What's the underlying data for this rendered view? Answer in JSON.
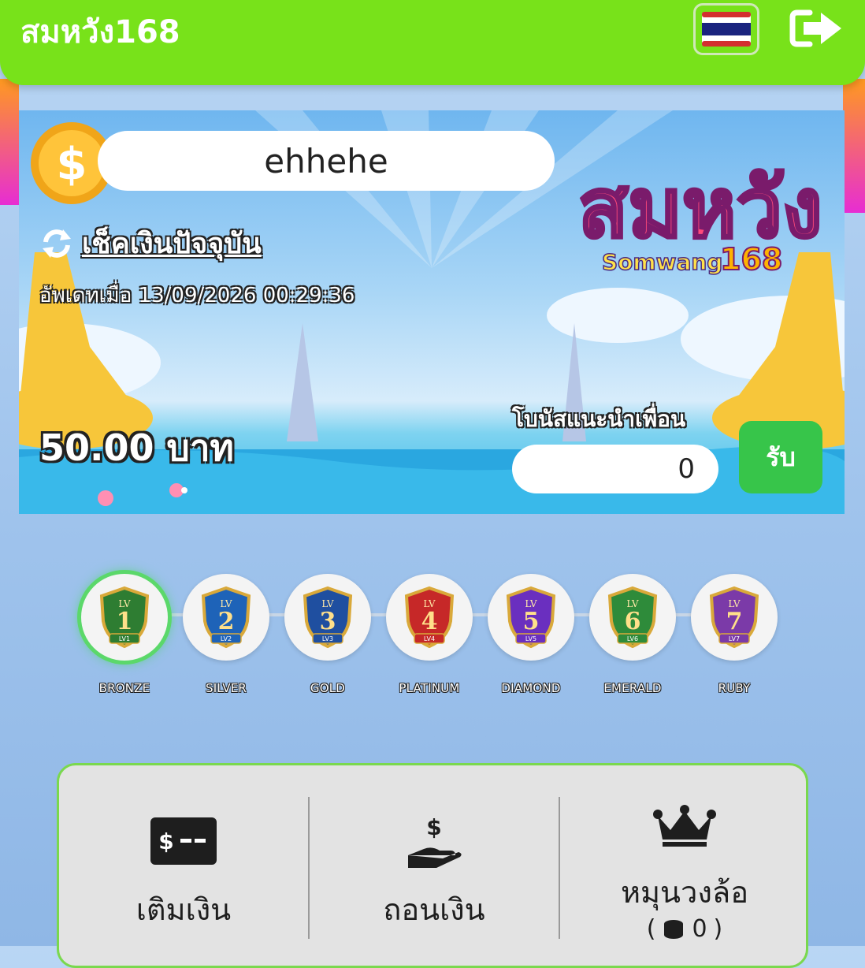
{
  "header": {
    "site_title": "สมหวัง168",
    "language_flag": "thailand-flag-icon",
    "logout_icon": "logout-icon"
  },
  "banner": {
    "username": "ehhehe",
    "check_balance_label": "เช็คเงินปัจจุบัน",
    "updated_at": "อัพเดทเมื่อ 13/09/2026 00:29:36",
    "balance_text": "50.00 บาท",
    "logo_text": "สมหวัง",
    "logo_sub": "Somwang",
    "logo_number": "168",
    "referral_label": "โบนัสแนะนำเพื่อน",
    "referral_value": "0",
    "claim_label": "รับ"
  },
  "levels": [
    {
      "num": "1",
      "lv": "LV",
      "tag": "LV1",
      "name": "BRONZE",
      "color": "#2e7d32",
      "active": true
    },
    {
      "num": "2",
      "lv": "LV",
      "tag": "LV2",
      "name": "SILVER",
      "color": "#1e63b8",
      "active": false
    },
    {
      "num": "3",
      "lv": "LV",
      "tag": "LV3",
      "name": "GOLD",
      "color": "#1f4fa0",
      "active": false
    },
    {
      "num": "4",
      "lv": "LV",
      "tag": "LV4",
      "name": "PLATINUM",
      "color": "#c62828",
      "active": false
    },
    {
      "num": "5",
      "lv": "LV",
      "tag": "LV5",
      "name": "DIAMOND",
      "color": "#6a2fbf",
      "active": false
    },
    {
      "num": "6",
      "lv": "LV",
      "tag": "LV6",
      "name": "EMERALD",
      "color": "#2e8b3a",
      "active": false
    },
    {
      "num": "7",
      "lv": "LV",
      "tag": "LV7",
      "name": "RUBY",
      "color": "#7b3aa8",
      "active": false
    }
  ],
  "actions": {
    "deposit_label": "เติมเงิน",
    "withdraw_label": "ถอนเงิน",
    "wheel_label": "หมุนวงล้อ",
    "wheel_count": "0",
    "paren_open": "(",
    "paren_close": ")"
  },
  "colors": {
    "header_green": "#78e21a",
    "claim_green": "#37c54a",
    "panel_border": "#7ad84e"
  }
}
